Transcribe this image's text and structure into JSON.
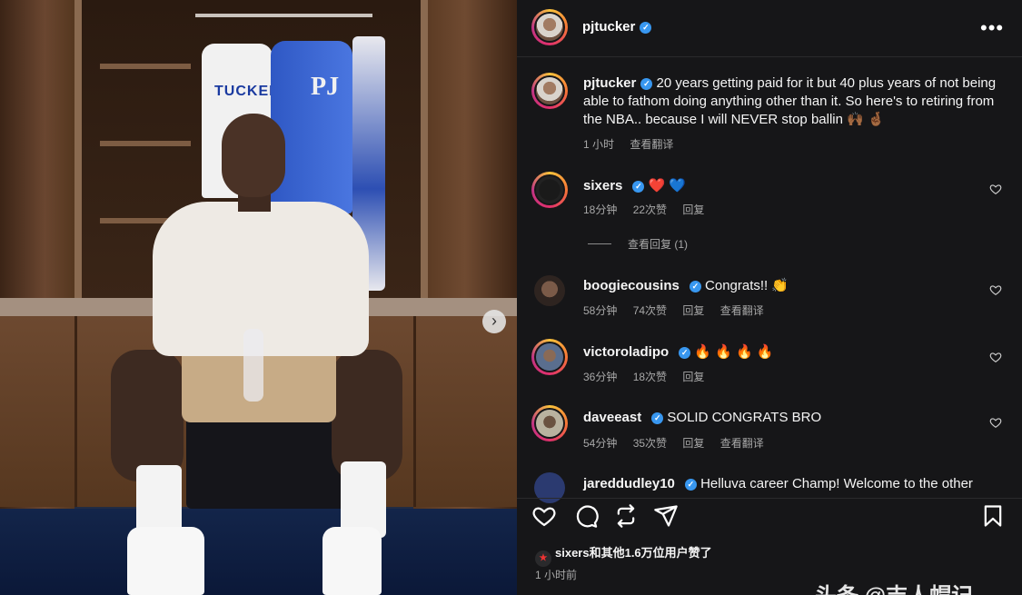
{
  "header": {
    "username": "pjtucker"
  },
  "caption": {
    "username": "pjtucker",
    "text": "20 years getting paid for it but 40 plus years of not being able to fathom doing anything other than it. So here's to retiring from the NBA.. because I will NEVER stop ballin 🙌🏾 🤞🏾",
    "time": "1 小时",
    "translate": "查看翻译"
  },
  "photo": {
    "jersey_text": "TUCKER",
    "jacket_text": "PJ"
  },
  "comments": [
    {
      "username": "sixers",
      "text": "❤️ 💙",
      "time": "18分钟",
      "likes": "22次赞",
      "reply": "回复",
      "translate": "",
      "replies": "查看回复 (1)"
    },
    {
      "username": "boogiecousins",
      "text": "Congrats!! 👏",
      "time": "58分钟",
      "likes": "74次赞",
      "reply": "回复",
      "translate": "查看翻译"
    },
    {
      "username": "victoroladipo",
      "text": "🔥 🔥 🔥 🔥",
      "time": "36分钟",
      "likes": "18次赞",
      "reply": "回复",
      "translate": ""
    },
    {
      "username": "daveeast",
      "text": "SOLID CONGRATS BRO",
      "time": "54分钟",
      "likes": "35次赞",
      "reply": "回复",
      "translate": "查看翻译"
    },
    {
      "username": "jareddudley10",
      "text": "Helluva career Champ! Welcome to the other"
    }
  ],
  "footer": {
    "likes_text": "sixers和其他1.6万位用户赞了",
    "time": "1 小时前",
    "watermark": "头条 @吉人帽记"
  },
  "colors": {
    "panel_bg": "#161618",
    "verified": "#3897f0",
    "muted": "#a8a8a8"
  }
}
